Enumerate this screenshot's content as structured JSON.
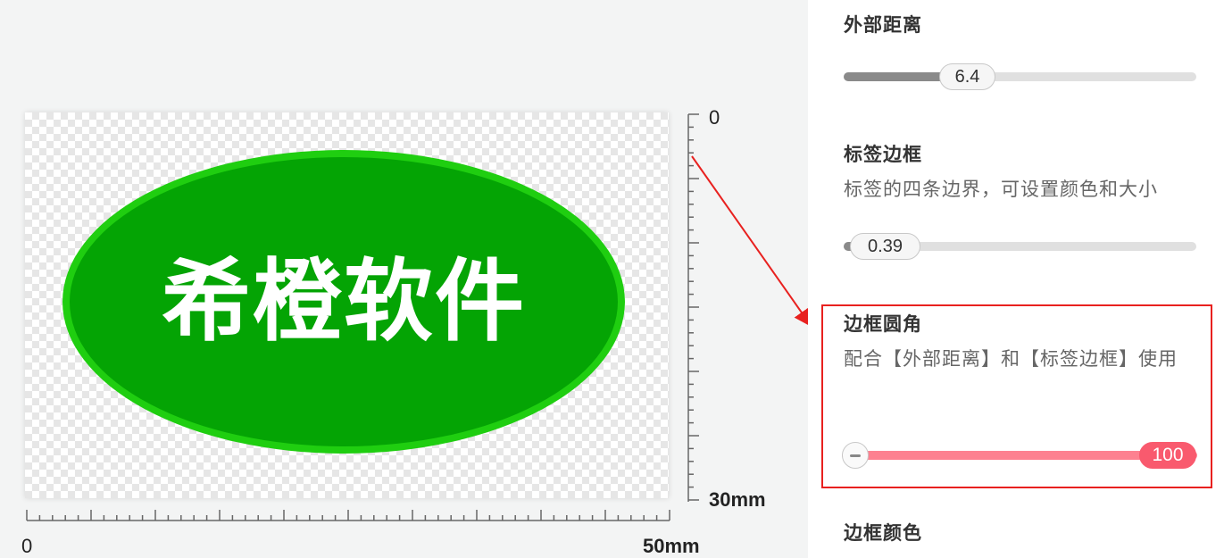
{
  "label": {
    "text": "希橙软件",
    "fill_color": "#04a404",
    "border_color": "#1fce10"
  },
  "rulers": {
    "vertical_start": "0",
    "vertical_end": "30mm",
    "horizontal_start": "0",
    "horizontal_end": "50mm"
  },
  "settings": {
    "outer_margin": {
      "title": "外部距离",
      "value": "6.4",
      "fraction": 0.29
    },
    "label_border": {
      "title": "标签边框",
      "description": "标签的四条边界，可设置颜色和大小",
      "value": "0.39",
      "fraction": 0.02
    },
    "border_radius": {
      "title": "边框圆角",
      "description": "配合【外部距离】和【标签边框】使用",
      "value": "100",
      "fraction": 1.0,
      "accent_color": "#f95a6e",
      "track_color": "#fd8190"
    },
    "border_color": {
      "title": "边框颜色"
    }
  },
  "annotation": {
    "color": "#e8211f"
  }
}
